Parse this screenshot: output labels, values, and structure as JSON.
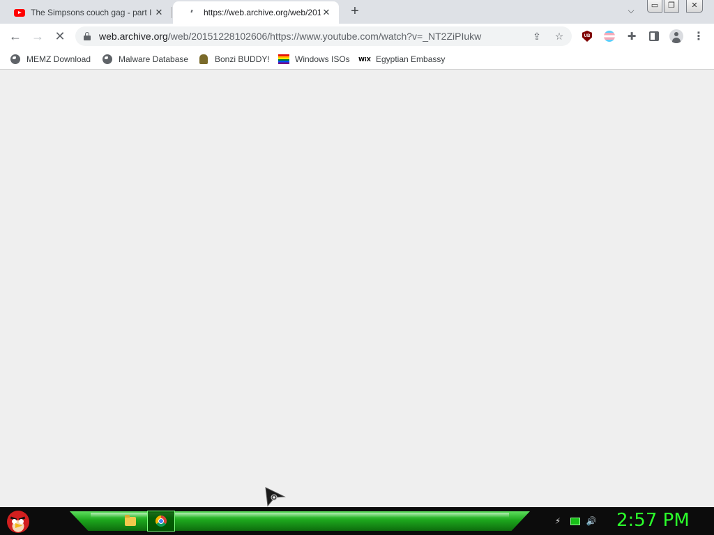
{
  "tabs": [
    {
      "title": "The Simpsons couch gag - part I",
      "icon": "youtube-icon",
      "active": false
    },
    {
      "title": "https://web.archive.org/web/201",
      "icon": "loading-icon",
      "active": true
    }
  ],
  "toolbar": {
    "url_host": "web.archive.org",
    "url_path": "/web/20151228102606/https://www.youtube.com/watch?v=_NT2ZiPIukw"
  },
  "bookmarks": [
    {
      "label": "MEMZ Download",
      "icon": "globe-icon"
    },
    {
      "label": "Malware Database",
      "icon": "globe-icon"
    },
    {
      "label": "Bonzi BUDDY!",
      "icon": "bonzi-icon"
    },
    {
      "label": "Windows ISOs",
      "icon": "rainbow-flag-icon"
    },
    {
      "label": "Egyptian Embassy",
      "icon": "wix-icon"
    }
  ],
  "taskbar": {
    "clock": "2:57 PM",
    "ublock_badge": "UB",
    "wix_text": "WiX"
  },
  "colors": {
    "tab_strip": "#dee1e6",
    "toolbar": "#ffffff",
    "content": "#efefef",
    "taskbar_green": "#1da61d",
    "clock_green": "#2bff2b"
  }
}
